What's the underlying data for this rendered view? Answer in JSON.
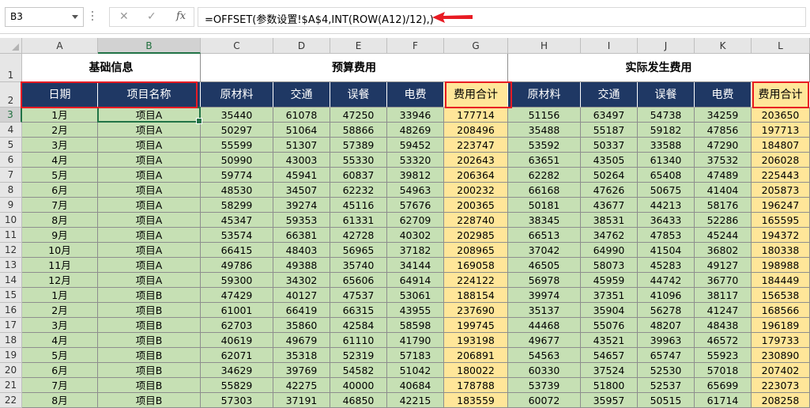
{
  "name_box": "B3",
  "formula_icons": {
    "cancel": "✕",
    "enter": "✓",
    "function": "fx"
  },
  "formula": "=OFFSET(参数设置!$A$4,INT(ROW(A12)/12),)",
  "columns": [
    "A",
    "B",
    "C",
    "D",
    "E",
    "F",
    "G",
    "H",
    "I",
    "J",
    "K",
    "L"
  ],
  "group_headers": {
    "basic": "基础信息",
    "budget": "预算费用",
    "actual": "实际发生费用"
  },
  "headers": [
    "日期",
    "项目名称",
    "原材料",
    "交通",
    "误餐",
    "电费",
    "费用合计",
    "原材料",
    "交通",
    "误餐",
    "电费",
    "费用合计"
  ],
  "row_numbers": [
    "1",
    "2",
    "3",
    "4",
    "5",
    "6",
    "7",
    "8",
    "9",
    "10",
    "11",
    "12",
    "13",
    "14",
    "15",
    "16",
    "17",
    "18",
    "19",
    "20",
    "21",
    "22"
  ],
  "rows": [
    [
      "1月",
      "项目A",
      "35440",
      "61078",
      "47250",
      "33946",
      "177714",
      "51156",
      "63497",
      "54738",
      "34259",
      "203650"
    ],
    [
      "2月",
      "项目A",
      "50297",
      "51064",
      "58866",
      "48269",
      "208496",
      "35488",
      "55187",
      "59182",
      "47856",
      "197713"
    ],
    [
      "3月",
      "项目A",
      "55599",
      "51307",
      "57389",
      "59452",
      "223747",
      "53592",
      "50337",
      "33588",
      "47290",
      "184807"
    ],
    [
      "4月",
      "项目A",
      "50990",
      "43003",
      "55330",
      "53320",
      "202643",
      "63651",
      "43505",
      "61340",
      "37532",
      "206028"
    ],
    [
      "5月",
      "项目A",
      "59774",
      "45941",
      "60837",
      "39812",
      "206364",
      "62282",
      "50264",
      "65408",
      "47489",
      "225443"
    ],
    [
      "6月",
      "项目A",
      "48530",
      "34507",
      "62232",
      "54963",
      "200232",
      "66168",
      "47626",
      "50675",
      "41404",
      "205873"
    ],
    [
      "7月",
      "项目A",
      "58299",
      "39274",
      "45116",
      "57676",
      "200365",
      "50181",
      "43677",
      "44213",
      "58176",
      "196247"
    ],
    [
      "8月",
      "项目A",
      "45347",
      "59353",
      "61331",
      "62709",
      "228740",
      "38345",
      "38531",
      "36433",
      "52286",
      "165595"
    ],
    [
      "9月",
      "项目A",
      "53574",
      "66381",
      "42728",
      "40302",
      "202985",
      "66513",
      "34762",
      "47853",
      "45244",
      "194372"
    ],
    [
      "10月",
      "项目A",
      "66415",
      "48403",
      "56965",
      "37182",
      "208965",
      "37042",
      "64990",
      "41504",
      "36802",
      "180338"
    ],
    [
      "11月",
      "项目A",
      "49786",
      "49388",
      "35740",
      "34144",
      "169058",
      "46505",
      "58073",
      "45283",
      "49127",
      "198988"
    ],
    [
      "12月",
      "项目A",
      "59300",
      "34302",
      "65606",
      "64914",
      "224122",
      "56978",
      "45959",
      "44742",
      "36770",
      "184449"
    ],
    [
      "1月",
      "项目B",
      "47429",
      "40127",
      "47537",
      "53061",
      "188154",
      "39974",
      "37351",
      "41096",
      "38117",
      "156538"
    ],
    [
      "2月",
      "项目B",
      "61001",
      "66419",
      "66315",
      "43955",
      "237690",
      "35137",
      "35904",
      "56278",
      "41247",
      "168566"
    ],
    [
      "3月",
      "项目B",
      "62703",
      "35860",
      "42584",
      "58598",
      "199745",
      "44468",
      "55076",
      "48207",
      "48438",
      "196189"
    ],
    [
      "4月",
      "项目B",
      "40619",
      "49679",
      "61110",
      "41790",
      "193198",
      "49677",
      "43521",
      "39963",
      "46572",
      "179733"
    ],
    [
      "5月",
      "项目B",
      "62071",
      "35318",
      "52319",
      "57183",
      "206891",
      "54563",
      "54657",
      "65747",
      "55923",
      "230890"
    ],
    [
      "6月",
      "项目B",
      "34629",
      "39769",
      "54582",
      "51042",
      "180022",
      "60330",
      "37524",
      "52530",
      "57018",
      "207402"
    ],
    [
      "7月",
      "项目B",
      "55829",
      "42275",
      "40000",
      "40684",
      "178788",
      "53739",
      "51800",
      "52537",
      "65699",
      "223073"
    ],
    [
      "8月",
      "项目B",
      "57303",
      "37191",
      "46850",
      "42215",
      "183559",
      "60072",
      "35957",
      "50515",
      "61714",
      "208258"
    ]
  ]
}
